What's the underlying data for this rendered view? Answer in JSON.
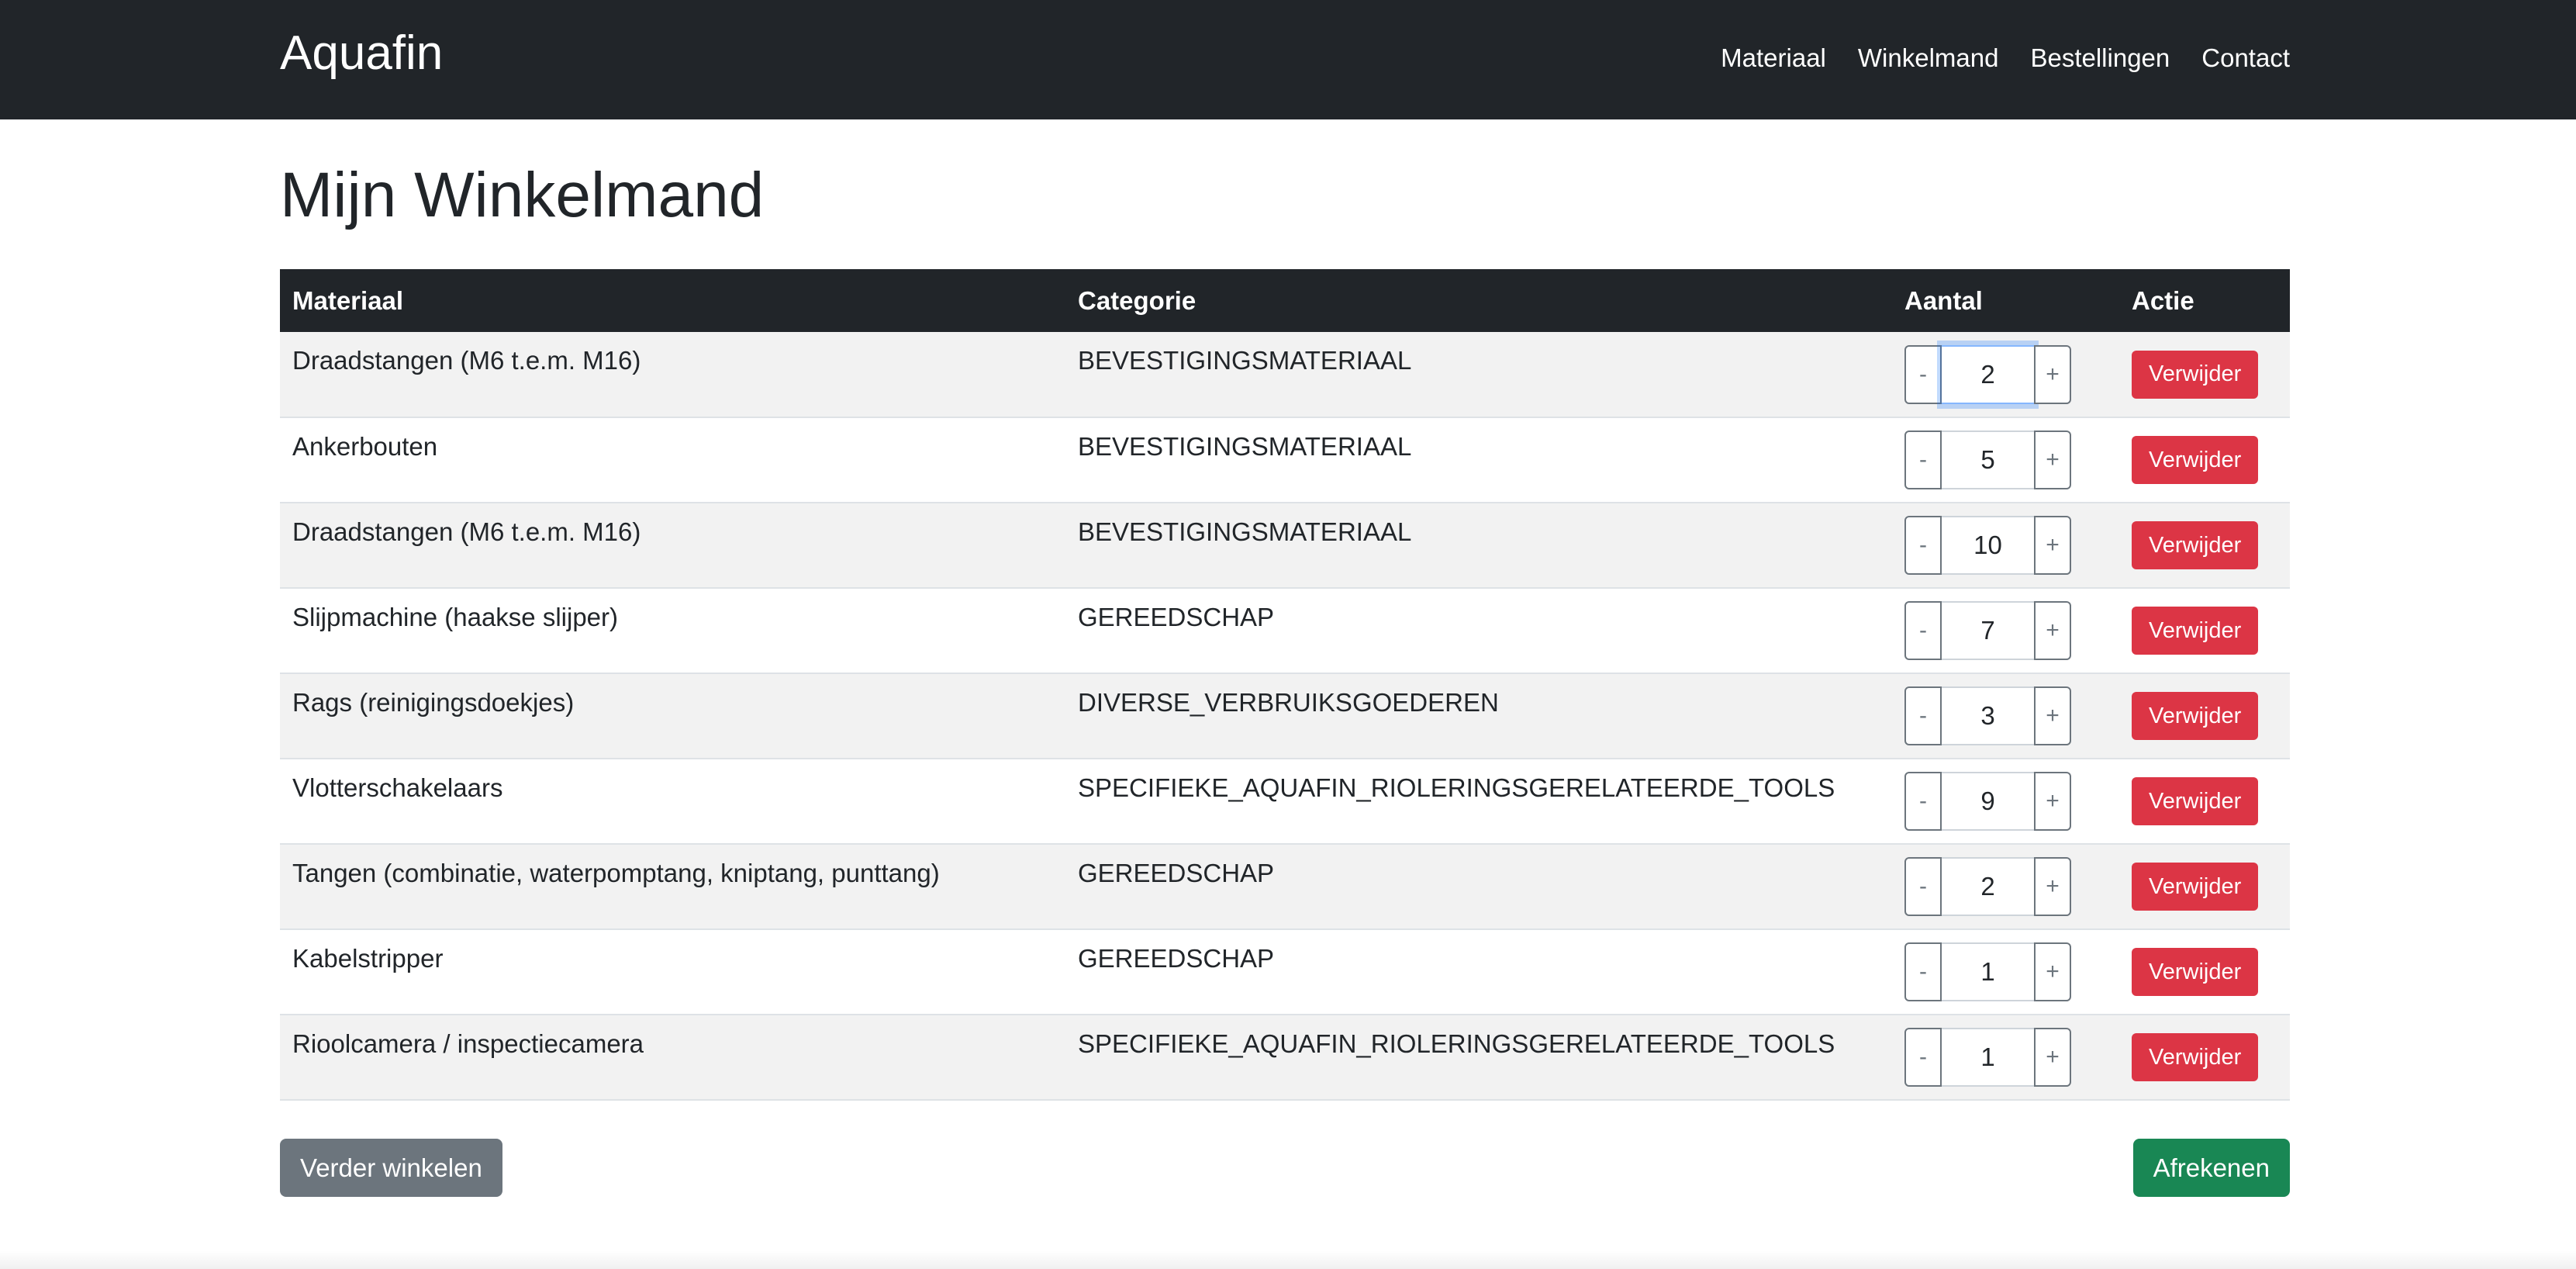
{
  "navbar": {
    "brand": "Aquafin",
    "links": [
      "Materiaal",
      "Winkelmand",
      "Bestellingen",
      "Contact"
    ]
  },
  "page": {
    "title": "Mijn Winkelmand"
  },
  "table": {
    "headers": [
      "Materiaal",
      "Categorie",
      "Aantal",
      "Actie"
    ],
    "rows": [
      {
        "materiaal": "Draadstangen (M6 t.e.m. M16)",
        "categorie": "BEVESTIGINGSMATERIAAL",
        "aantal": "2",
        "actie": "Verwijder"
      },
      {
        "materiaal": "Ankerbouten",
        "categorie": "BEVESTIGINGSMATERIAAL",
        "aantal": "5",
        "actie": "Verwijder"
      },
      {
        "materiaal": "Draadstangen (M6 t.e.m. M16)",
        "categorie": "BEVESTIGINGSMATERIAAL",
        "aantal": "10",
        "actie": "Verwijder"
      },
      {
        "materiaal": "Slijpmachine (haakse slijper)",
        "categorie": "GEREEDSCHAP",
        "aantal": "7",
        "actie": "Verwijder"
      },
      {
        "materiaal": "Rags (reinigingsdoekjes)",
        "categorie": "DIVERSE_VERBRUIKSGOEDEREN",
        "aantal": "3",
        "actie": "Verwijder"
      },
      {
        "materiaal": "Vlotterschakelaars",
        "categorie": "SPECIFIEKE_AQUAFIN_RIOLERINGSGERELATEERDE_TOOLS",
        "aantal": "9",
        "actie": "Verwijder"
      },
      {
        "materiaal": "Tangen (combinatie, waterpomptang, kniptang, punttang)",
        "categorie": "GEREEDSCHAP",
        "aantal": "2",
        "actie": "Verwijder"
      },
      {
        "materiaal": "Kabelstripper",
        "categorie": "GEREEDSCHAP",
        "aantal": "1",
        "actie": "Verwijder"
      },
      {
        "materiaal": "Rioolcamera / inspectiecamera",
        "categorie": "SPECIFIEKE_AQUAFIN_RIOLERINGSGERELATEERDE_TOOLS",
        "aantal": "1",
        "actie": "Verwijder"
      }
    ],
    "minus_label": "-",
    "plus_label": "+"
  },
  "actions": {
    "continue_label": "Verder winkelen",
    "checkout_label": "Afrekenen"
  },
  "colors": {
    "navbar_bg": "#212529",
    "danger": "#dc3545",
    "success": "#198754",
    "secondary": "#6c757d"
  }
}
